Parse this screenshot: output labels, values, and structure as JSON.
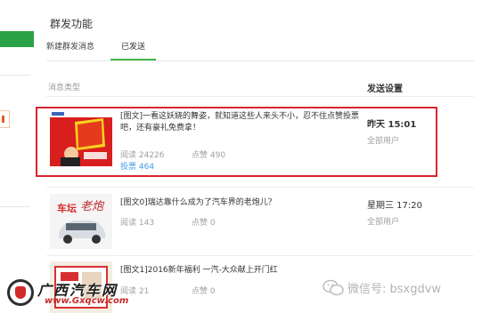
{
  "page": {
    "title": "群发功能"
  },
  "tabs": [
    {
      "label": "新建群发消息"
    },
    {
      "label": "已发送"
    }
  ],
  "columns": {
    "type": "消息类型",
    "time": "发送设置"
  },
  "messages": [
    {
      "title": "[图文]一看这妖娆的舞姿，就知道这些人来头不小，忍不住点赞投票吧，还有豪礼免费拿！",
      "reads_label": "阅读 24226",
      "likes_label": "点赞 490",
      "votes_label": "投票 464",
      "time": "昨天 15:01",
      "recipient": "全部用户"
    },
    {
      "title": "[图文0]瑞达靠什么成为了汽车界的老炮儿？",
      "reads_label": "阅读 143",
      "likes_label": "点赞 0",
      "time": "星期三 17:20",
      "recipient": "全部用户"
    },
    {
      "title": "[图文1]2016新年福利 一汽-大众献上开门红",
      "reads_label": "阅读 21",
      "likes_label": "点赞 0"
    }
  ],
  "watermark": {
    "site_name": "广西汽车网",
    "site_url": "www.Gxqcw.com",
    "wechat": "微信号: bsxgdvw"
  },
  "colors": {
    "accent_green": "#44b549",
    "highlight_red": "#d9252e",
    "vote_blue": "#459ae9"
  }
}
